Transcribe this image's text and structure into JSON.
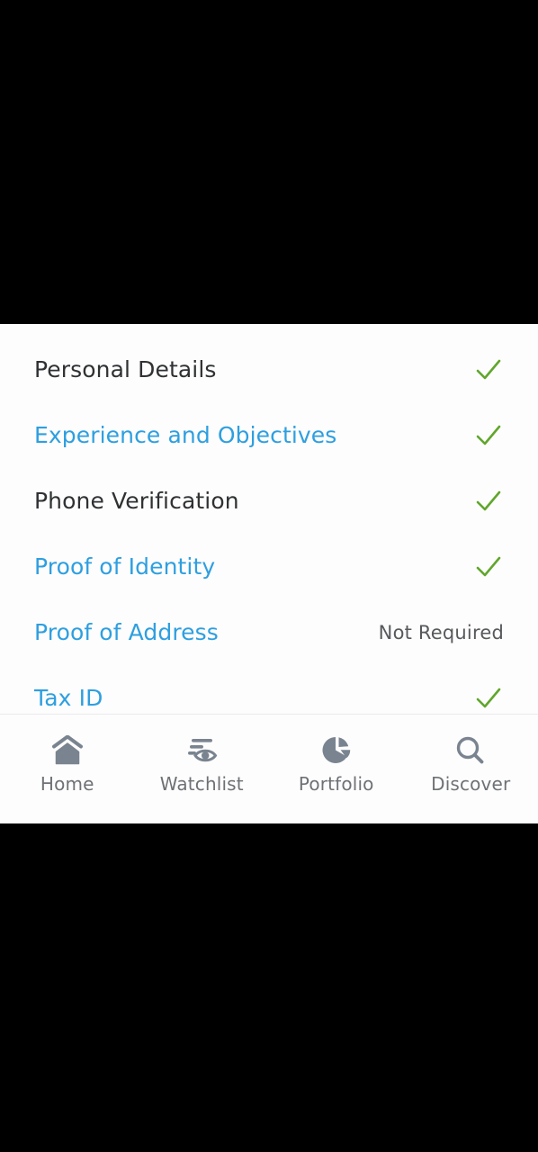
{
  "theme": {
    "letterbox_color": "#000000",
    "surface_color": "#fdfdfd",
    "link_color": "#2e9fe0",
    "text_color": "#2f3133",
    "muted_text_color": "#575a5c",
    "check_color": "#61a62c",
    "nav_icon_color": "#7a8490",
    "nav_label_color": "#6e7276",
    "divider_color": "#e9eaec"
  },
  "checklist": {
    "items": [
      {
        "label": "Personal Details",
        "style": "dark",
        "status_type": "check",
        "status_text": "",
        "status_icon": "check-icon"
      },
      {
        "label": "Experience and Objectives",
        "style": "link",
        "status_type": "check",
        "status_text": "",
        "status_icon": "check-icon"
      },
      {
        "label": "Phone Verification",
        "style": "dark",
        "status_type": "check",
        "status_text": "",
        "status_icon": "check-icon"
      },
      {
        "label": "Proof of Identity",
        "style": "link",
        "status_type": "check",
        "status_text": "",
        "status_icon": "check-icon"
      },
      {
        "label": "Proof of Address",
        "style": "link",
        "status_type": "text",
        "status_text": "Not Required",
        "status_icon": ""
      },
      {
        "label": "Tax ID",
        "style": "link",
        "status_type": "check",
        "status_text": "",
        "status_icon": "check-icon"
      }
    ]
  },
  "bottom_nav": {
    "items": [
      {
        "label": "Home",
        "icon": "home-icon"
      },
      {
        "label": "Watchlist",
        "icon": "eye-watchlist-icon"
      },
      {
        "label": "Portfolio",
        "icon": "pie-chart-icon"
      },
      {
        "label": "Discover",
        "icon": "search-magnifier-icon"
      }
    ]
  }
}
